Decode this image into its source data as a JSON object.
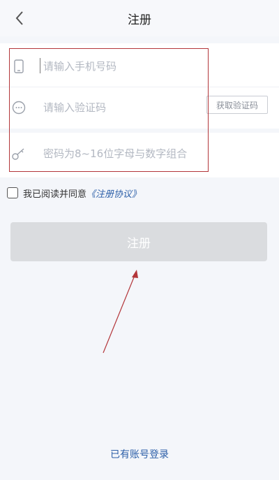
{
  "header": {
    "title": "注册"
  },
  "form": {
    "phone_placeholder": "请输入手机号码",
    "code_placeholder": "请输入验证码",
    "password_placeholder": "密码为8~16位字母与数字组合",
    "get_code_label": "获取验证码"
  },
  "agreement": {
    "text": "我已阅读并同意",
    "link": "《注册协议》"
  },
  "submit_label": "注册",
  "login_link": "已有账号登录",
  "colors": {
    "accent": "#2c5fa8",
    "annotation": "#b3363a",
    "button_disabled": "#dadcdf"
  }
}
